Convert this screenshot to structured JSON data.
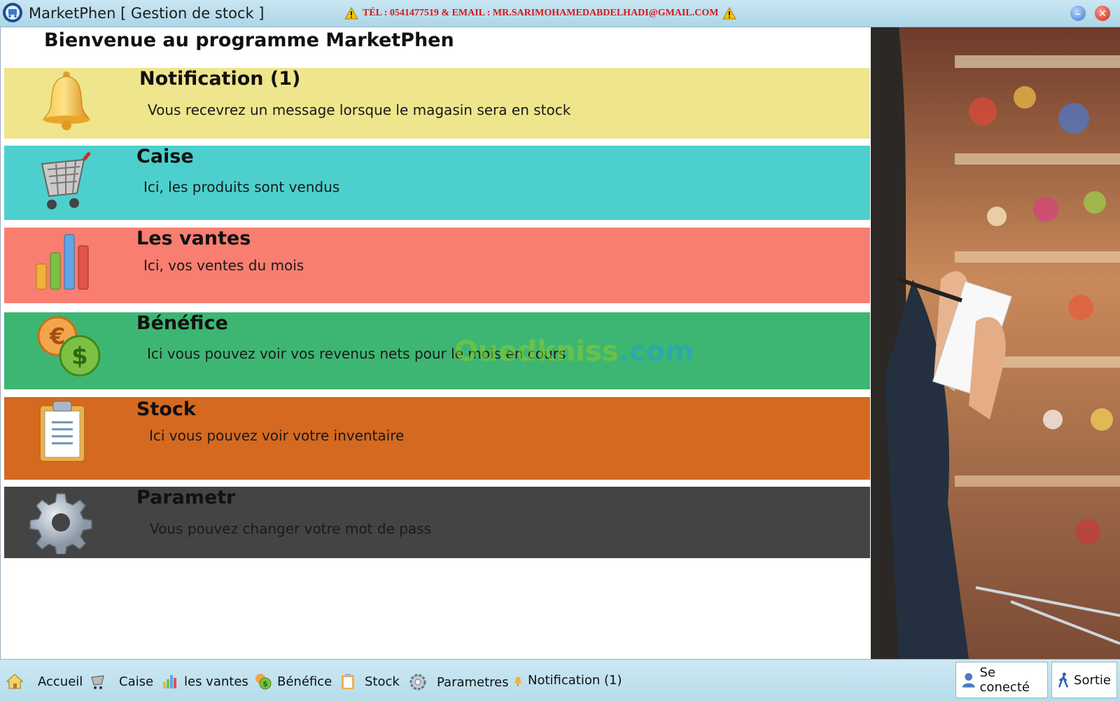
{
  "window": {
    "title": "MarketPhen [ Gestion de stock ]",
    "contact": "TÉL : 0541477519 & EMAIL : MR.SARIMOHAMEDABDELHADI@GMAIL.COM",
    "contact_color": "#d8161b"
  },
  "main": {
    "welcome": "Bienvenue au programme MarketPhen",
    "cards": [
      {
        "title": "Notification (1)",
        "desc": "Vous recevrez un message lorsque le magasin sera en stock",
        "color": "#efe58c",
        "icon": "bell-icon"
      },
      {
        "title": "Caise",
        "desc": "Ici, les produits sont vendus",
        "color": "#4dd0cd",
        "icon": "shopping-cart-icon"
      },
      {
        "title": "Les vantes",
        "desc": "Ici, vos ventes du mois",
        "color": "#f87e71",
        "icon": "bar-chart-icon"
      },
      {
        "title": "Bénéfice",
        "desc": "Ici vous pouvez voir vos revenus nets pour le mois en cours",
        "color": "#3eb673",
        "icon": "currency-coins-icon"
      },
      {
        "title": "Stock",
        "desc": "Ici vous pouvez voir votre inventaire",
        "color": "#d56920",
        "icon": "clipboard-icon"
      },
      {
        "title": "Parametr",
        "desc": "Vous pouvez changer votre mot de pass",
        "color": "#444444",
        "icon": "gear-icon"
      }
    ]
  },
  "watermark": {
    "part1": "Ouedkniss",
    "part2": ".com"
  },
  "taskbar": {
    "items": [
      {
        "label": "Accueil",
        "icon": "home-icon"
      },
      {
        "label": "Caise",
        "icon": "cart-icon"
      },
      {
        "label": "les vantes",
        "icon": "chart-icon"
      },
      {
        "label": "Bénéfice",
        "icon": "coins-icon"
      },
      {
        "label": "Stock",
        "icon": "clipboard-icon"
      },
      {
        "label": "Parametres",
        "icon": "gear-icon"
      },
      {
        "label": "Notification (1)",
        "icon": "bell-icon"
      }
    ],
    "connect_label": "Se conecté",
    "exit_label": "Sortie"
  }
}
